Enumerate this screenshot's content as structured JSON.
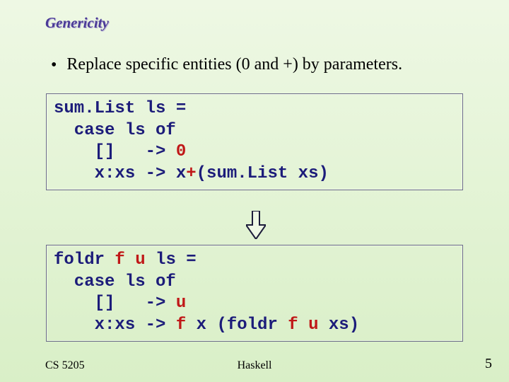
{
  "title": "Genericity",
  "bullet": "Replace specific entities (0 and +) by parameters.",
  "code1": {
    "l1a": "sum.List ls =",
    "l2a": "  case ls of",
    "l3a": "    []   -> ",
    "l3b": "0",
    "l4a": "    x:xs -> x",
    "l4b": "+",
    "l4c": "(sum.List xs)"
  },
  "code2": {
    "l1a": "foldr ",
    "l1b": "f u",
    "l1c": " ls =",
    "l2a": "  case ls of",
    "l3a": "    []   -> ",
    "l3b": "u",
    "l4a": "    x:xs -> ",
    "l4b": "f",
    "l4c": " x (foldr ",
    "l4d": "f u",
    "l4e": " xs)"
  },
  "footer": {
    "left": "CS 5205",
    "center": "Haskell",
    "right": "5"
  }
}
